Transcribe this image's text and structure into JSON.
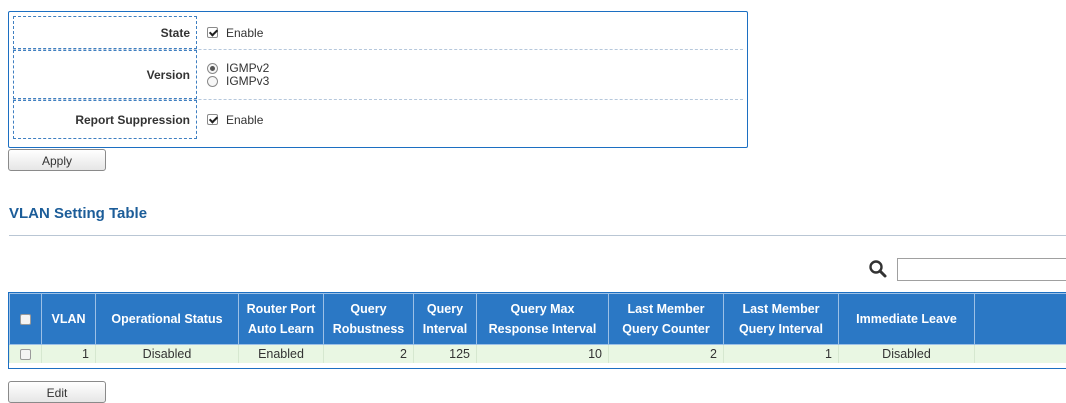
{
  "form": {
    "rows": [
      {
        "label": "State",
        "options": [
          {
            "type": "checkbox",
            "text": "Enable",
            "checked": true
          }
        ]
      },
      {
        "label": "Version",
        "options": [
          {
            "type": "radio",
            "text": "IGMPv2",
            "checked": true
          },
          {
            "type": "radio",
            "text": "IGMPv3",
            "checked": false
          }
        ]
      },
      {
        "label": "Report Suppression",
        "options": [
          {
            "type": "checkbox",
            "text": "Enable",
            "checked": true
          }
        ]
      }
    ]
  },
  "buttons": {
    "apply": "Apply",
    "edit": "Edit"
  },
  "section": {
    "title": "VLAN Setting Table"
  },
  "search": {
    "value": "",
    "placeholder": ""
  },
  "table": {
    "headers": [
      {
        "line1": "VLAN",
        "line2": ""
      },
      {
        "line1": "Operational Status",
        "line2": ""
      },
      {
        "line1": "Router Port",
        "line2": "Auto Learn"
      },
      {
        "line1": "Query",
        "line2": "Robustness"
      },
      {
        "line1": "Query",
        "line2": "Interval"
      },
      {
        "line1": "Query Max",
        "line2": "Response Interval"
      },
      {
        "line1": "Last Member",
        "line2": "Query Counter"
      },
      {
        "line1": "Last Member",
        "line2": "Query Interval"
      },
      {
        "line1": "Immediate Leave",
        "line2": ""
      }
    ],
    "rows": [
      {
        "vlan": "1",
        "operational_status": "Disabled",
        "router_port_auto_learn": "Enabled",
        "query_robustness": "2",
        "query_interval": "125",
        "query_max_response_interval": "10",
        "last_member_query_counter": "2",
        "last_member_query_interval": "1",
        "immediate_leave": "Disabled"
      }
    ]
  },
  "colors": {
    "accent": "#1c6fc2",
    "header_bg": "#2b78c5",
    "row_bg": "#e9f7e3",
    "title": "#1c5d99"
  }
}
